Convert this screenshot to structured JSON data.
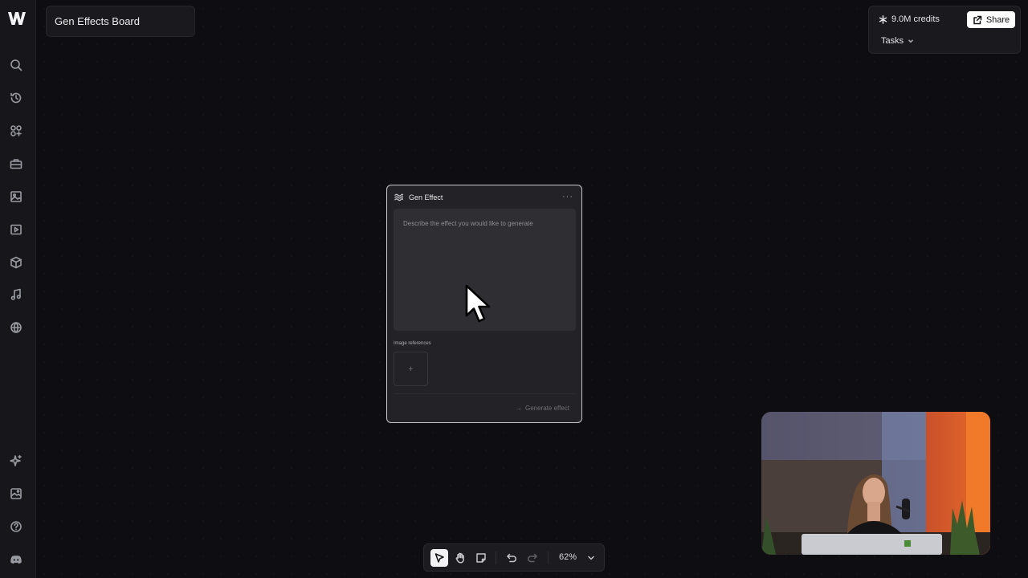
{
  "board": {
    "title": "Gen Effects Board"
  },
  "topbar": {
    "credits": "9.0M credits",
    "share_label": "Share",
    "tasks_label": "Tasks"
  },
  "node": {
    "title": "Gen Effect",
    "prompt_placeholder": "Describe the effect you would like to generate",
    "image_refs_label": "Image references",
    "add_symbol": "+",
    "more_symbol": "···",
    "generate_label": "Generate effect",
    "generate_arrow": "→"
  },
  "toolbar": {
    "zoom": "62%"
  },
  "sidebar": {
    "top_icons": [
      "search-icon",
      "history-icon",
      "apps-icon",
      "toolbox-icon",
      "image-icon",
      "video-icon",
      "3d-box-icon",
      "music-icon",
      "globe-icon"
    ],
    "bottom_icons": [
      "sparkle-icon",
      "gallery-icon",
      "help-icon",
      "discord-icon"
    ]
  },
  "colors": {
    "background": "#0e0d12",
    "panel": "#1a1a1e",
    "accent": "#ffffff"
  }
}
